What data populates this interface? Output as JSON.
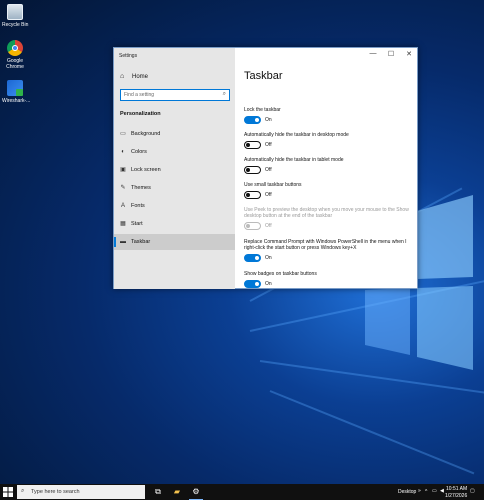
{
  "desktop": {
    "icons": [
      {
        "label": "Recycle Bin",
        "icon": "recycle-bin-icon"
      },
      {
        "label": "Google Chrome",
        "icon": "chrome-icon"
      },
      {
        "label": "Wireshark-...",
        "icon": "wireshark-icon"
      }
    ]
  },
  "window": {
    "title": "Settings",
    "minimize": "—",
    "maximize": "☐",
    "close": "✕"
  },
  "sidebar": {
    "home_label": "Home",
    "search_placeholder": "Find a setting",
    "section": "Personalization",
    "items": [
      {
        "label": "Background",
        "icon": "picture-icon",
        "glyph": "▭"
      },
      {
        "label": "Colors",
        "icon": "palette-icon",
        "glyph": "◐"
      },
      {
        "label": "Lock screen",
        "icon": "monitor-icon",
        "glyph": "▣"
      },
      {
        "label": "Themes",
        "icon": "brush-icon",
        "glyph": "✎"
      },
      {
        "label": "Fonts",
        "icon": "font-icon",
        "glyph": "A"
      },
      {
        "label": "Start",
        "icon": "start-icon",
        "glyph": "▦"
      },
      {
        "label": "Taskbar",
        "icon": "taskbar-icon",
        "glyph": "▬"
      }
    ]
  },
  "content": {
    "title": "Taskbar",
    "settings": [
      {
        "label": "Lock the taskbar",
        "state": "On",
        "on": true,
        "disabled": false
      },
      {
        "label": "Automatically hide the taskbar in desktop mode",
        "state": "Off",
        "on": false,
        "disabled": false
      },
      {
        "label": "Automatically hide the taskbar in tablet mode",
        "state": "Off",
        "on": false,
        "disabled": false
      },
      {
        "label": "Use small taskbar buttons",
        "state": "Off",
        "on": false,
        "disabled": false
      },
      {
        "label": "Use Peek to preview the desktop when you move your mouse to the Show desktop button at the end of the taskbar",
        "state": "Off",
        "on": false,
        "disabled": true
      },
      {
        "label": "Replace Command Prompt with Windows PowerShell in the menu when I right-click the start button or press Windows key+X",
        "state": "On",
        "on": true,
        "disabled": false
      },
      {
        "label": "Show badges on taskbar buttons",
        "state": "On",
        "on": true,
        "disabled": false
      }
    ]
  },
  "taskbar": {
    "search_placeholder": "Type here to search",
    "apps": [
      {
        "icon": "task-view-icon",
        "glyph": "⧉"
      },
      {
        "icon": "file-explorer-icon",
        "glyph": "▰"
      },
      {
        "icon": "settings-gear-icon",
        "glyph": "⚙"
      }
    ],
    "desktop_label": "Desktop",
    "time": "10:51 AM",
    "date": "1/27/2026"
  },
  "colors": {
    "accent": "#0078d7",
    "taskbar": "#101010"
  }
}
